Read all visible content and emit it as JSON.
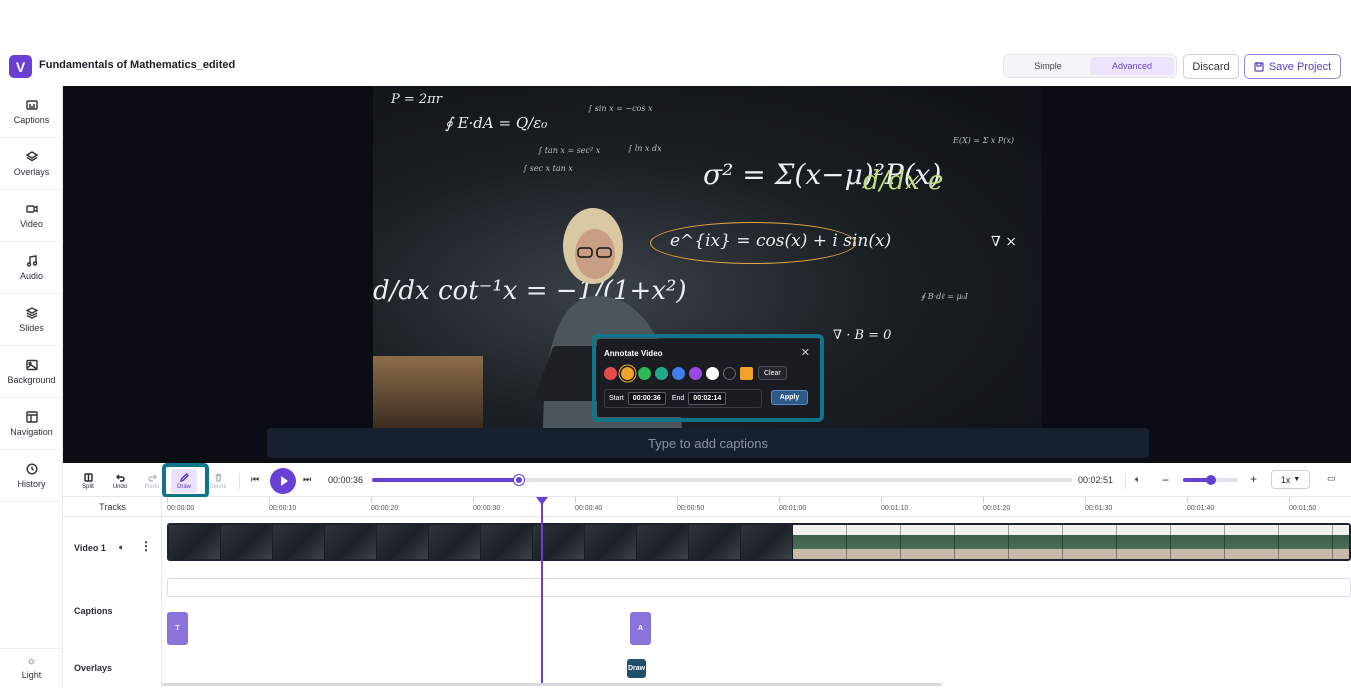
{
  "header": {
    "logo_letter": "V",
    "project_title": "Fundamentals of Mathematics_edited",
    "modes": [
      "Simple",
      "Advanced"
    ],
    "active_mode": "Advanced",
    "discard_label": "Discard",
    "save_label": "Save Project"
  },
  "sidebar": {
    "items": [
      {
        "label": "Captions",
        "icon": "captions-icon"
      },
      {
        "label": "Overlays",
        "icon": "layers-icon"
      },
      {
        "label": "Video",
        "icon": "video-camera-icon"
      },
      {
        "label": "Audio",
        "icon": "music-note-icon"
      },
      {
        "label": "Slides",
        "icon": "slides-stack-icon"
      },
      {
        "label": "Background",
        "icon": "image-icon"
      },
      {
        "label": "Navigation",
        "icon": "layout-icon"
      },
      {
        "label": "History",
        "icon": "history-clock-icon"
      }
    ],
    "theme_label": "Light"
  },
  "stage": {
    "caption_placeholder": "Type to add captions",
    "annotated_equation": "e^{ix} = cos(x) + i sin(x)"
  },
  "annotate_popup": {
    "title": "Annotate Video",
    "colors": [
      "#e84a4a",
      "#f0a12a",
      "#2fb85a",
      "#22a88f",
      "#3f7de8",
      "#9b48e0",
      "#ffffff",
      "#1a1c22"
    ],
    "selected_color": "#f0a12a",
    "custom_color": "#f0a12a",
    "clear_label": "Clear",
    "start_label": "Start",
    "start_value": "00:00:36",
    "end_label": "End",
    "end_value": "00:02:14",
    "apply_label": "Apply"
  },
  "toolbar": {
    "tools": [
      {
        "label": "Split",
        "disabled": false
      },
      {
        "label": "Undo",
        "disabled": false
      },
      {
        "label": "Redo",
        "disabled": true
      },
      {
        "label": "Draw",
        "disabled": false,
        "active": true
      },
      {
        "label": "Delete",
        "disabled": true
      }
    ],
    "current_time": "00:00:36",
    "total_time": "00:02:51",
    "progress_fraction": 0.21,
    "zoom_fraction": 0.5,
    "speed": "1x"
  },
  "timeline": {
    "tracks_header": "Tracks",
    "ticks": [
      "00:00:00",
      "00:00:10",
      "00:00:20",
      "00:00:30",
      "00:00:40",
      "00:00:50",
      "00:01:00",
      "00:01:10",
      "00:01:20",
      "00:01:30",
      "00:01:40",
      "00:01:50"
    ],
    "track_labels": {
      "video": "Video 1",
      "captions": "Captions",
      "overlays": "Overlays"
    },
    "caption_clips": [
      "T",
      "A"
    ],
    "overlay_clip": "Draw"
  },
  "colors": {
    "accent": "#6a3fd6",
    "highlight": "#10748a"
  }
}
